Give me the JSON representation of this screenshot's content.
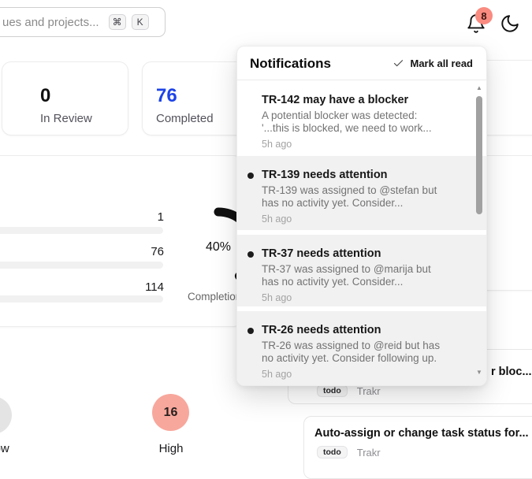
{
  "topbar": {
    "search": {
      "placeholder": "ues and projects...",
      "kbd_cmd": "⌘",
      "kbd_k": "K"
    },
    "notifications_count": "8",
    "icons": {
      "bell": "bell-icon",
      "moon": "moon-icon"
    }
  },
  "stats": [
    {
      "value": "0",
      "label": "In Review",
      "color": "#111111"
    },
    {
      "value": "76",
      "label": "Completed",
      "color": "#1d43e8"
    }
  ],
  "chart_data": [
    {
      "type": "bar",
      "orientation": "horizontal",
      "values": [
        1,
        76,
        114
      ],
      "value_labels": [
        "1",
        "76",
        "114"
      ],
      "legend_position": "none",
      "grid": false
    },
    {
      "type": "pie",
      "values": [
        40,
        60
      ],
      "center_label": "40%",
      "title": "Completion",
      "arc_color": "#111111"
    }
  ],
  "priority": {
    "low": {
      "label": "Low"
    },
    "high": {
      "value": "16",
      "label": "High"
    }
  },
  "suggestions": [
    {
      "title": "r bloc...",
      "badge": "todo",
      "source": "Trakr"
    },
    {
      "title": "Auto-assign or change task status for...",
      "badge": "todo",
      "source": "Trakr"
    }
  ],
  "notifications_panel": {
    "title": "Notifications",
    "mark_all_read": "Mark all read",
    "items": [
      {
        "title": "TR-142 may have a blocker",
        "body_line1": "A potential blocker was detected:",
        "body_line2": "'...this is blocked, we need to work...",
        "time": "5h ago",
        "unread": false
      },
      {
        "title": "TR-139 needs attention",
        "body_line1": "TR-139 was assigned to @stefan but",
        "body_line2": "has no activity yet. Consider...",
        "time": "5h ago",
        "unread": true
      },
      {
        "title": "TR-37 needs attention",
        "body_line1": "TR-37 was assigned to @marija but",
        "body_line2": "has no activity yet. Consider...",
        "time": "5h ago",
        "unread": true
      },
      {
        "title": "TR-26 needs attention",
        "body_line1": "TR-26 was assigned to @reid but has",
        "body_line2": "no activity yet. Consider following up.",
        "time": "5h ago",
        "unread": true
      }
    ],
    "scroll": {
      "up": "▲",
      "down": "▼"
    }
  },
  "colors": {
    "accent_blue": "#1d43e8",
    "badge_salmon": "#f98b80",
    "high_circle": "#f8a79c",
    "low_circle": "#e4e4e4",
    "unread_bg": "#f1f1f2"
  }
}
